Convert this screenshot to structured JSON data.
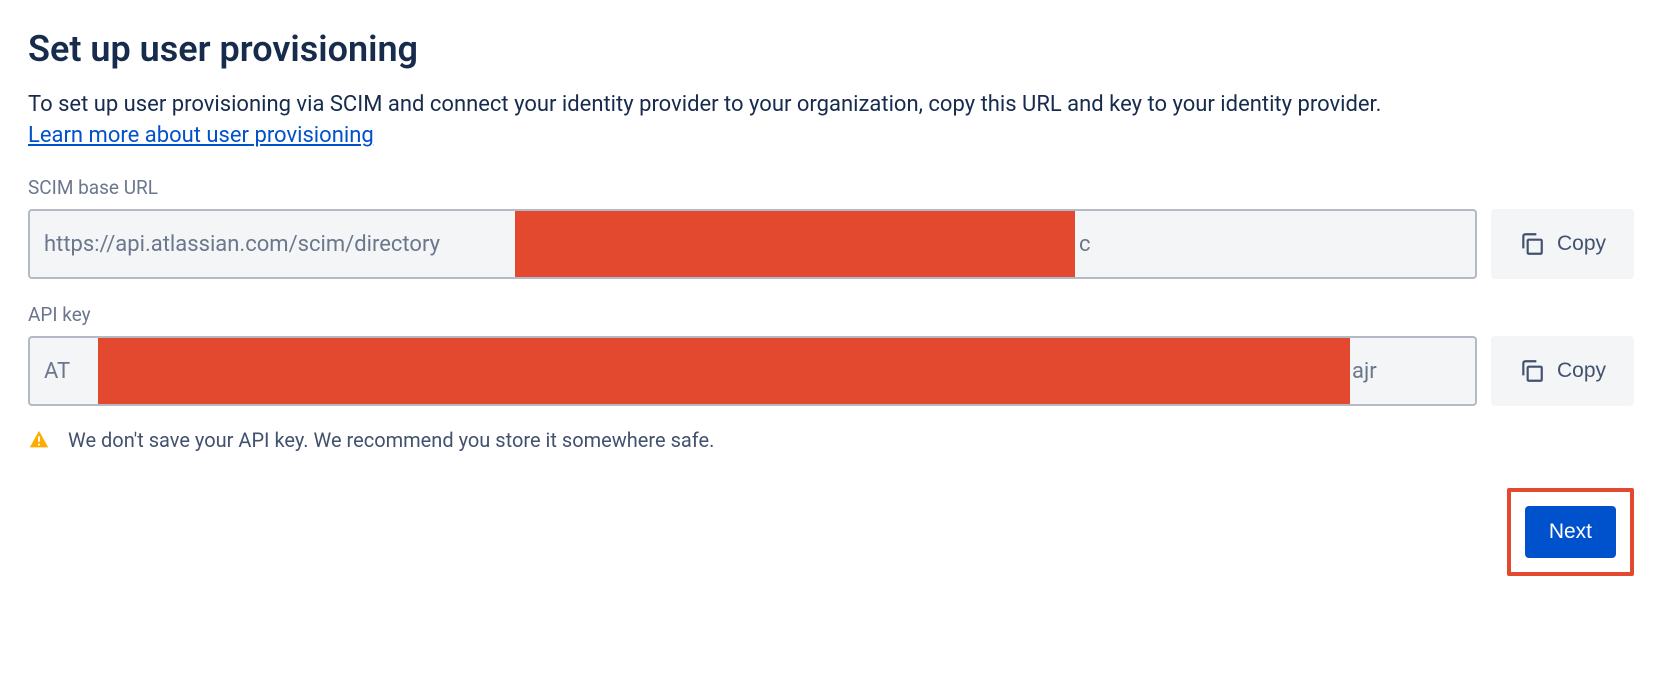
{
  "page": {
    "title": "Set up user provisioning",
    "description": "To set up user provisioning via SCIM and connect your identity provider to your organization, copy this URL and key to your identity provider.",
    "learn_link": "Learn more about user provisioning"
  },
  "fields": {
    "scim_url": {
      "label": "SCIM base URL",
      "value_prefix": "https://api.atlassian.com/scim/directory",
      "value_visible_suffix": "c",
      "copy_label": "Copy"
    },
    "api_key": {
      "label": "API key",
      "value_prefix": "AT",
      "value_visible_suffix": "ajr",
      "copy_label": "Copy"
    }
  },
  "warning": {
    "text": "We don't save your API key. We recommend you store it somewhere safe."
  },
  "footer": {
    "next_label": "Next"
  },
  "icons": {
    "copy": "copy-icon",
    "warning": "warning-icon"
  }
}
